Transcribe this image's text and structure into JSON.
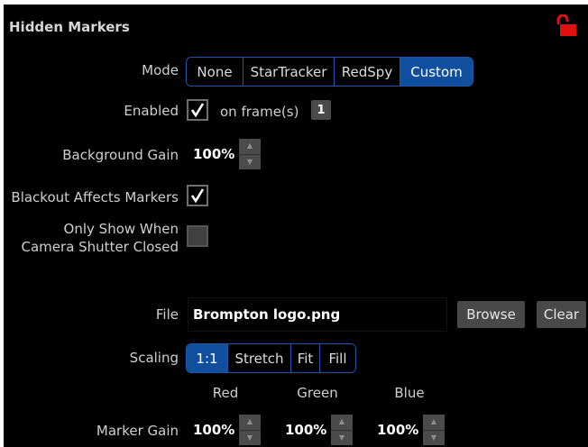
{
  "panel": {
    "title": "Hidden Markers",
    "lock_icon": "unlocked-padlock-icon",
    "lock_color": "#e01010"
  },
  "mode": {
    "label": "Mode",
    "options": [
      "None",
      "StarTracker",
      "RedSpy",
      "Custom"
    ],
    "selected": "Custom"
  },
  "enabled": {
    "label": "Enabled",
    "checked": true,
    "frames_label": "on frame(s)",
    "frame_number": "1"
  },
  "background_gain": {
    "label": "Background Gain",
    "value": "100%"
  },
  "blackout": {
    "label": "Blackout Affects Markers",
    "checked": true
  },
  "only_show": {
    "label": "Only Show When Camera Shutter Closed",
    "checked": false
  },
  "file": {
    "label": "File",
    "value": "Brompton logo.png",
    "browse_label": "Browse",
    "clear_label": "Clear"
  },
  "scaling": {
    "label": "Scaling",
    "options": [
      "1:1",
      "Stretch",
      "Fit",
      "Fill"
    ],
    "selected": "1:1"
  },
  "marker_gain": {
    "label": "Marker Gain",
    "columns": [
      "Red",
      "Green",
      "Blue"
    ],
    "values": [
      "100%",
      "100%",
      "100%"
    ]
  },
  "colors": {
    "accent": "#0f4f9e",
    "panel_bg": "#000000",
    "button_bg": "#484848"
  }
}
